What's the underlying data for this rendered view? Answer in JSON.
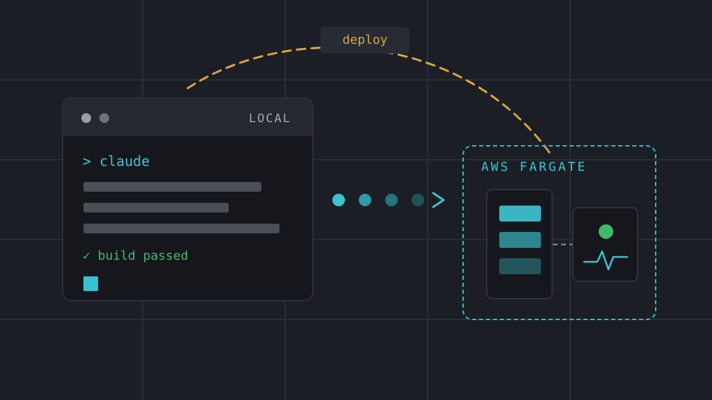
{
  "deploy": {
    "label": "deploy"
  },
  "terminal": {
    "title": "LOCAL",
    "prompt": "> claude",
    "status": "✓ build passed"
  },
  "fargate": {
    "title": "AWS FARGATE"
  },
  "colors": {
    "background": "#1b1e25",
    "accent_cyan": "#3cc4d0",
    "accent_orange": "#d9a441",
    "success_green": "#3dbb6a"
  },
  "icons": {
    "flow_arrow": "chevron-right-icon",
    "monitor": "heartbeat-pulse-icon",
    "status": "health-status-dot"
  }
}
